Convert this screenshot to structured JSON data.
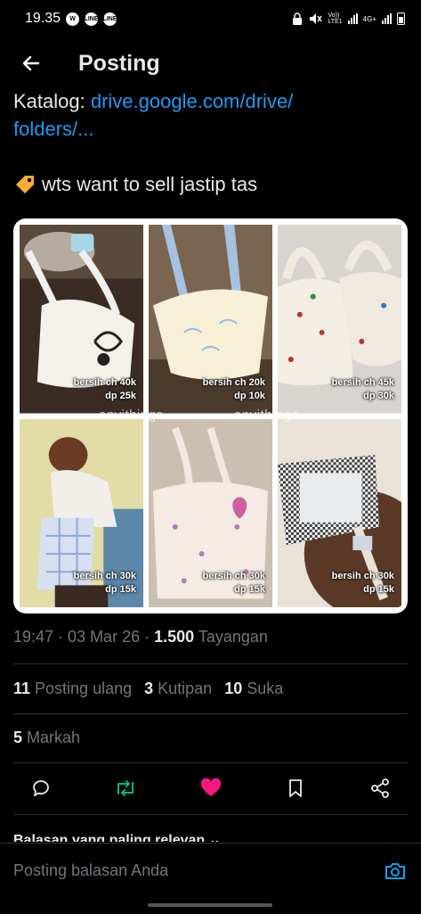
{
  "status": {
    "time": "19.35",
    "apps": [
      "W",
      "LINE",
      "LINE"
    ],
    "network_lte": "Vo))\nLTE1",
    "network_4g": "4G+"
  },
  "header": {
    "title": "Posting",
    "back_icon": "arrow-left-icon"
  },
  "post": {
    "catalog_label": "Katalog: ",
    "catalog_link": "drive.google.com/drive/\nfolders/...",
    "text_emoji": "tag-emoji",
    "text": "wts want to sell jastip tas",
    "images": [
      {
        "caption": "bersih ch 40k\ndp 25k"
      },
      {
        "caption": "bersih ch 20k\ndp 10k"
      },
      {
        "caption": "bersih ch 45k\ndp 30k"
      },
      {
        "caption": "bersih ch 30k\ndp 15k"
      },
      {
        "caption": "bersih ch 30k\ndp 15k"
      },
      {
        "caption": "bersih ch 30k\ndp 15k"
      }
    ],
    "watermark": "anvithings"
  },
  "meta": {
    "time_date": "19:47 · 03 Mar 26 · ",
    "views_count": "1.500",
    "views_label": " Tayangan"
  },
  "stats": {
    "reposts_count": "11",
    "reposts_label": "Posting ulang",
    "quotes_count": "3",
    "quotes_label": "Kutipan",
    "likes_count": "10",
    "likes_label": "Suka",
    "bookmarks_count": "5",
    "bookmarks_label": "Markah"
  },
  "actions": [
    "reply-icon",
    "repost-icon",
    "like-icon",
    "bookmark-icon",
    "share-icon"
  ],
  "colors": {
    "link": "#1d9bf0",
    "repost": "#00ba7c",
    "like": "#f91880",
    "muted": "#71767b"
  },
  "replies": {
    "relevance_label": "Balasan yang paling relevan ⌄",
    "placeholder": "Posting balasan Anda"
  }
}
